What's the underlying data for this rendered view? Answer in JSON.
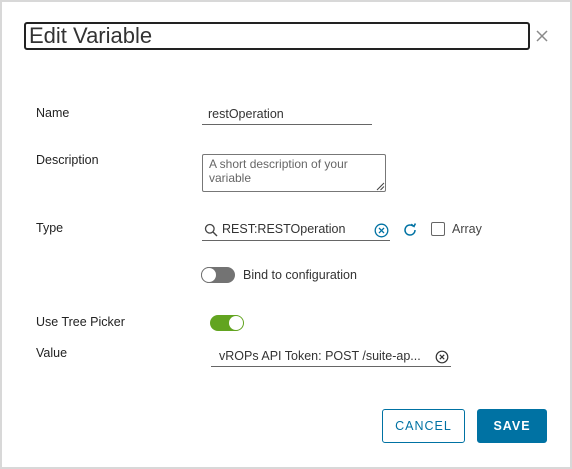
{
  "dialog": {
    "title": "Edit Variable"
  },
  "fields": {
    "name": {
      "label": "Name",
      "value": "restOperation"
    },
    "description": {
      "label": "Description",
      "placeholder": "A short description of your variable"
    },
    "type": {
      "label": "Type",
      "value": "REST:RESTOperation",
      "array_label": "Array",
      "array_checked": false
    },
    "bind": {
      "label": "Bind to configuration",
      "enabled": false
    },
    "tree_picker": {
      "label": "Use Tree Picker",
      "enabled": true
    },
    "value": {
      "label": "Value",
      "value": "vROPs API Token: POST /suite-ap..."
    }
  },
  "buttons": {
    "cancel_label": "CANCEL",
    "save_label": "SAVE"
  },
  "colors": {
    "accent": "#0072a3",
    "toggle_on": "#62a420",
    "toggle_off": "#737373"
  },
  "icons": {
    "close": "close-icon",
    "search": "search-icon",
    "clear": "clear-circle-icon",
    "refresh": "refresh-icon"
  }
}
